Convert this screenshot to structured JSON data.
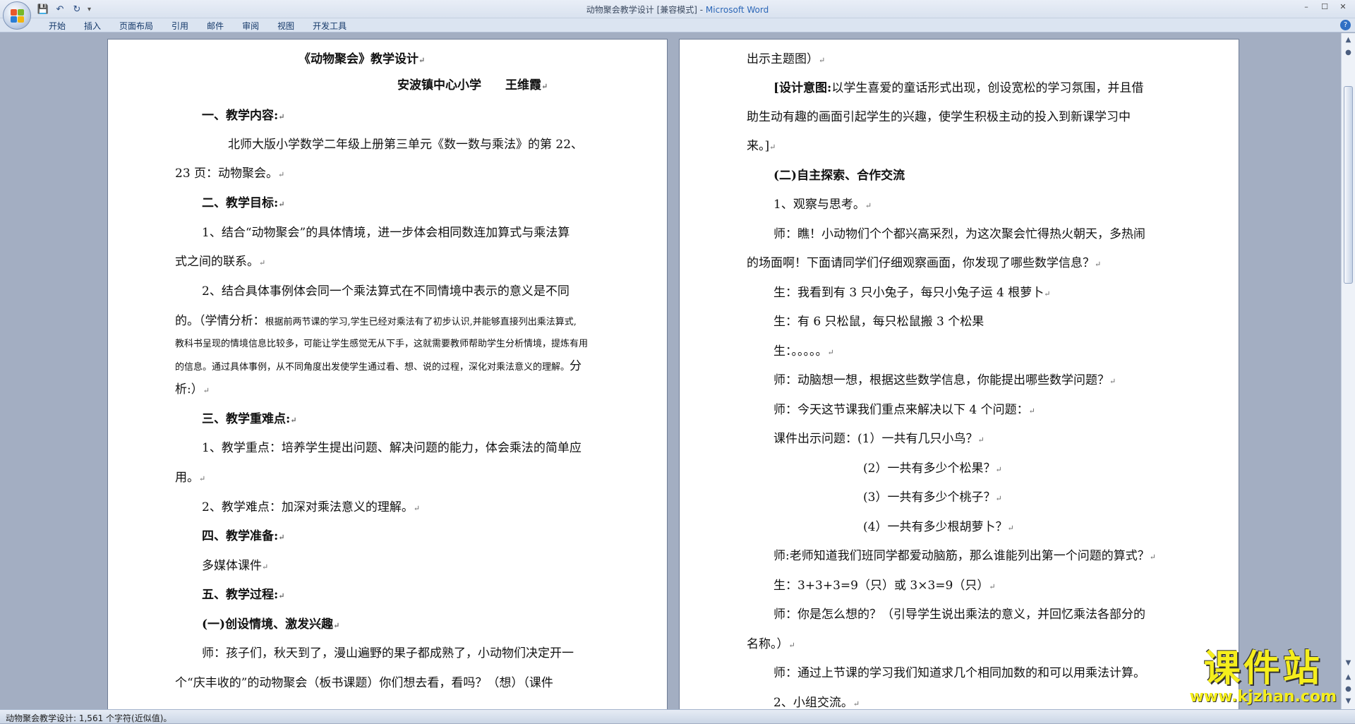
{
  "window": {
    "title_doc": "动物聚会教学设计 [兼容模式] - ",
    "title_app": "Microsoft Word",
    "controls": [
      "–",
      "☐",
      "✕"
    ]
  },
  "qat": {
    "save": "💾",
    "undo": "↶",
    "redo": "↻",
    "more": "▾"
  },
  "ribbon": {
    "tabs": [
      "开始",
      "插入",
      "页面布局",
      "引用",
      "邮件",
      "审阅",
      "视图",
      "开发工具"
    ],
    "help": "?"
  },
  "left_page": [
    "《动物聚会》教学设计",
    "安波镇中心小学　　王维霞",
    "一、教学内容:",
    "北师大版小学数学二年级上册第三单元《数一数与乘法》的第 22、",
    "23 页：动物聚会。",
    "二、教学目标:",
    "1、结合“动物聚会”的具体情境，进一步体会相同数连加算式与乘法算",
    "式之间的联系。",
    "2、结合具体事例体会同一个乘法算式在不同情境中表示的意义是不同",
    "的。（学情分析：",
    "根据前两节课的学习,学生已经对乘法有了初步认识,并能够直接列出乘法算式,",
    "教科书呈现的情境信息比较多，可能让学生感觉无从下手，这就需要教师帮助学生分析情境，提炼有用",
    "的信息。通过具体事例，从不同角度出发使学生通过看、想、说的过程，深化对乘法意义的理解。",
    "分",
    "析:）",
    "三、教学重难点:",
    "1、教学重点：培养学生提出问题、解决问题的能力，体会乘法的简单应",
    "用。",
    "2、教学难点：加深对乘法意义的理解。",
    "四、教学准备:",
    "多媒体课件",
    "五、教学过程:",
    "(一)创设情境、激发兴趣",
    "师：孩子们，秋天到了，漫山遍野的果子都成熟了，小动物们决定开一",
    "个“庆丰收的”的动物聚会（板书课题）你们想去看，看吗？（想）（课件"
  ],
  "right_page": [
    "出示主题图）",
    "[设计意图:",
    "以学生喜爱的童话形式出现，创设宽松的学习氛围，并且借",
    "助生动有趣的画面引起学生的兴趣，使学生积极主动的投入到新课学习中",
    "来。]",
    "(二)自主探索、合作交流",
    "1、观察与思考。",
    "师：瞧！小动物们个个都兴高采烈，为这次聚会忙得热火朝天，多热闹",
    "的场面啊！下面请同学们仔细观察画面，你发现了哪些数学信息？",
    "生：我看到有 3 只小兔子，每只小兔子运 4 根萝卜",
    "生：有 6 只松鼠，每只松鼠搬 3 个松果",
    "生：。。。。。",
    "师：动脑想一想，根据这些数学信息，你能提出哪些数学问题？",
    "师：今天这节课我们重点来解决以下 4 个问题：",
    "课件出示问题：(1）一共有几只小鸟？",
    "(2）一共有多少个松果？",
    "(3）一共有多少个桃子？",
    "(4）一共有多少根胡萝卜？",
    "师:老师知道我们班同学都爱动脑筋，那么谁能列出第一个问题的算式？",
    "生：3+3+3=9（只）或 3×3=9（只）",
    "师：你是怎么想的？（引导学生说出乘法的意义，并回忆乘法各部分的",
    "名称。）",
    "师：通过上节课的学习我们知道求几个相同加数的和可以用乘法计算。",
    "2、小组交流。"
  ],
  "para_mark": "↵",
  "status": {
    "text": "动物聚会教学设计: 1,561 个字符(近似值)。"
  },
  "scroll": {
    "up": "▲",
    "down": "▼",
    "prev": "▲",
    "next": "▼",
    "browse": "●"
  },
  "watermark": {
    "main": "课件站",
    "sub": "www.kjzhan.com"
  },
  "colors": {
    "title_app": "#2b66b7",
    "watermark": "#f5ee1c",
    "workspace": "#a3aec2"
  }
}
